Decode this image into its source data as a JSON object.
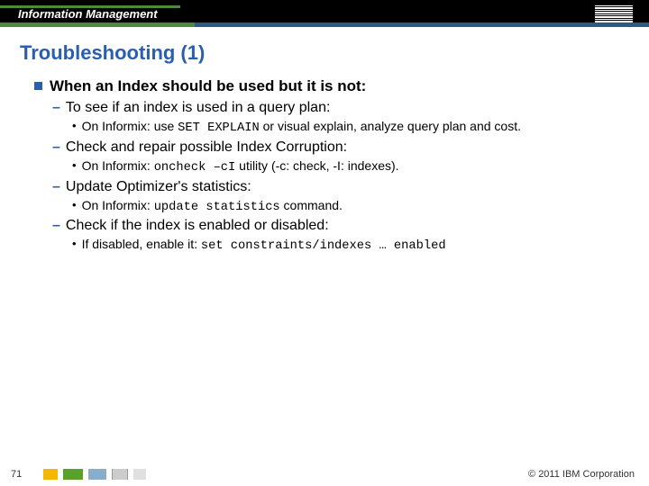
{
  "header": {
    "brand": "Information Management",
    "logo": "IBM"
  },
  "title": "Troubleshooting (1)",
  "content": {
    "l1": "When an Index should be used but it is not:",
    "items": [
      {
        "l2": "To see if an index is used in a query plan:",
        "l3_pre": "On Informix: use ",
        "l3_code": "SET EXPLAIN",
        "l3_post": " or visual explain, analyze query plan and cost."
      },
      {
        "l2": "Check and repair possible Index Corruption:",
        "l3_pre": "On Informix: ",
        "l3_code": "oncheck –cI",
        "l3_post": " utility (-c: check, -I: indexes)."
      },
      {
        "l2": "Update Optimizer's statistics:",
        "l3_pre": "On Informix: ",
        "l3_code": "update statistics",
        "l3_post": " command."
      },
      {
        "l2": "Check if the index is enabled or disabled:",
        "l3_pre": "If disabled, enable it: ",
        "l3_code": "set constraints/indexes … enabled",
        "l3_post": ""
      }
    ]
  },
  "footer": {
    "page": "71",
    "copyright": "© 2011 IBM Corporation"
  }
}
